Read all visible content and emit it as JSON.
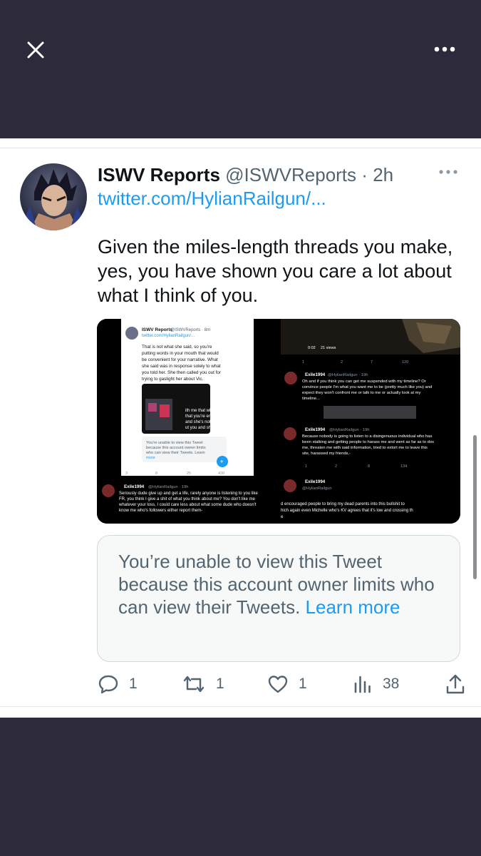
{
  "tweet": {
    "display_name": "ISWV Reports",
    "handle": "@ISWVReports",
    "separator": "·",
    "time": "2h",
    "link": "twitter.com/HylianRailgun/...",
    "text": "Given the miles-length threads you make, yes, you have shown you care a lot about what I think of you."
  },
  "media": {
    "image1": {
      "header_name": "ISWV Reports",
      "header_meta": "@ISWVReports · 8m",
      "header_link": "twitter.com/HylianRailgun/...",
      "body_lines": [
        "That is not what she said, so you're",
        "putting words in your mouth that would",
        "be convenient for your narrative. What",
        "she said was in response solely to what",
        "you told her. She then called you out for",
        "trying to gaslight her about Vic."
      ],
      "quoted_lines": [
        "ith me that what y",
        "that you're encou",
        "and she's not happ",
        "ut you and she's KV"
      ],
      "unable_lines": [
        "You're unable to view this Tweet",
        "because this account owner limits",
        "who can view their Tweets. Learn",
        "more"
      ],
      "counts": [
        "3",
        "8",
        "25",
        "438"
      ],
      "reply_name": "Exile1994",
      "reply_handle": "@HylianRailgun · 19h",
      "reply_lines": [
        "Seriously dude give up and get a life, rarely anyone is listening to you like",
        "FR, you think I give a shit of what you think about me? You don't like me",
        "whatever your loss, I could care less about what some dude who doesn't",
        "know me who's followers either report them-"
      ]
    },
    "image2": {
      "video_time": "0:02",
      "video_views": "21 views",
      "counts": [
        "1",
        "2",
        "7",
        "120"
      ],
      "reply_name": "Exile1994",
      "reply_handle": "@HylianRailgun · 19h",
      "reply_lines": [
        "Oh and if you think you can get me suspended with my timeline? Or",
        "convince people I'm  what you want me to be (pretty much like you) and",
        "expect they won't confront me or talk to me or actually look at my",
        "timeline..."
      ]
    },
    "image3": {
      "reply_name": "Exile1994",
      "reply_handle": "@HylianRailgun · 19h",
      "reply_lines": [
        "Because nobody is going to listen to a disingenuous individual who has",
        "been stalking and getting people to harass me and went as far as to dox",
        "me, threaten me with said information, tried to extort me to leave this",
        "site, harassed my friends,-"
      ],
      "counts": [
        "1",
        "2",
        "8",
        "134"
      ],
      "reply2_name": "Exile1994",
      "reply2_handle": "@HylianRailgun",
      "reply2_lines": [
        "d encouraged people to bring my dead parents into this bullshit to",
        "hich again even Michelle who's KV agrees that it's low and crossing th",
        "e"
      ]
    }
  },
  "quoted_tweet": {
    "text": "You’re unable to view this Tweet because this account owner limits who can view their Tweets.",
    "link_label": "Learn more"
  },
  "actions": {
    "replies": "1",
    "retweets": "1",
    "likes": "1",
    "views": "38"
  },
  "colors": {
    "background_dark": "#2d2a3c",
    "link_blue": "#1d9bf0",
    "muted_gray": "#536471"
  }
}
